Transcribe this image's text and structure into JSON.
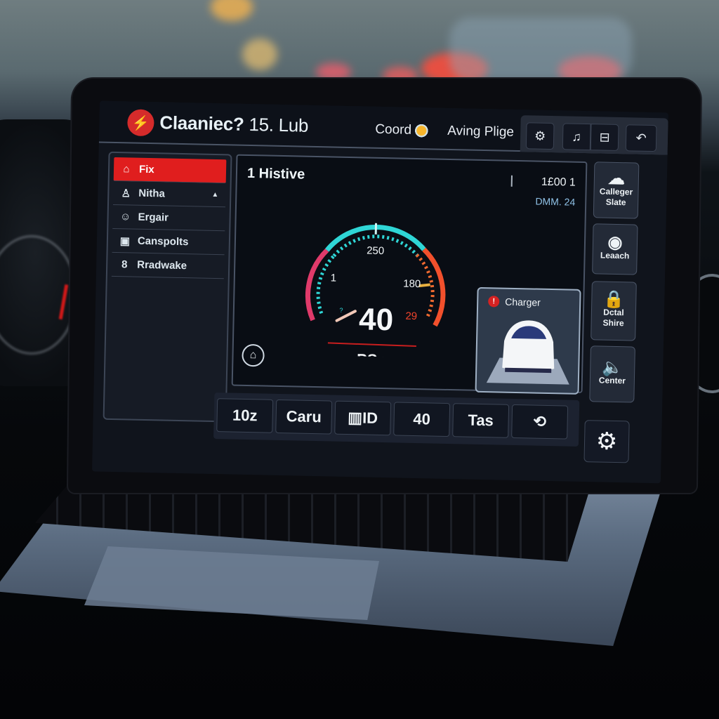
{
  "app": {
    "title": "Claaniec?",
    "version": "15. Lub",
    "header_items": [
      {
        "label": "Coord",
        "icon": "sun-icon"
      },
      {
        "label": "Aving Plige"
      }
    ],
    "toolbar": [
      {
        "name": "diagnostic-tool-button",
        "icon": "engine-icon",
        "glyph": "⚙"
      },
      {
        "name": "sound-button",
        "icon": "sound-wave-icon",
        "glyph": "♫"
      },
      {
        "name": "window-button",
        "icon": "window-icon",
        "glyph": "⊟"
      },
      {
        "name": "back-button",
        "icon": "undo-icon",
        "glyph": "↶"
      }
    ]
  },
  "sidebar": {
    "items": [
      {
        "label": "Fix",
        "icon": "home-icon",
        "glyph": "⌂",
        "active": true
      },
      {
        "label": "Nitha",
        "icon": "person-icon",
        "glyph": "♙",
        "caret": "▲"
      },
      {
        "label": "Ergair",
        "icon": "face-icon",
        "glyph": "☺"
      },
      {
        "label": "Canspolts",
        "icon": "device-icon",
        "glyph": "▣"
      },
      {
        "label": "Rradwake",
        "icon": "kettlebell-icon",
        "glyph": "8"
      }
    ]
  },
  "main": {
    "title": "1 Histive",
    "record_id": "1£00 1",
    "record_date": "DMM. 24",
    "gauge": {
      "value": "40",
      "unit": "PSn",
      "labels": {
        "top": "250",
        "left": "1",
        "right": "180",
        "warn": "29",
        "low": "?"
      }
    },
    "charger": {
      "label": "Charger",
      "badge": "!"
    }
  },
  "right_panel": [
    {
      "label": "Calleger Slate",
      "icon": "cloud-icon",
      "glyph": "☁"
    },
    {
      "label": "Leaach",
      "icon": "webcam-gear-icon",
      "glyph": "◉"
    },
    {
      "label": "Dctal Shire",
      "icon": "lock-icon",
      "glyph": "🔒"
    },
    {
      "label": "Center",
      "icon": "speaker-icon",
      "glyph": "🔈"
    }
  ],
  "bottom_bar": [
    {
      "label": "10z"
    },
    {
      "label": "Caru"
    },
    {
      "label": "▥ID"
    },
    {
      "label": "40"
    },
    {
      "label": "Tas"
    },
    {
      "label": "⟲"
    }
  ],
  "settings_glyph": "⚙",
  "home_glyph": "⌂",
  "colors": {
    "accent_red": "#e01e1e",
    "gauge_cyan": "#2fd6d6",
    "gauge_orange": "#f26a2c",
    "gauge_magenta": "#d13fa8"
  }
}
